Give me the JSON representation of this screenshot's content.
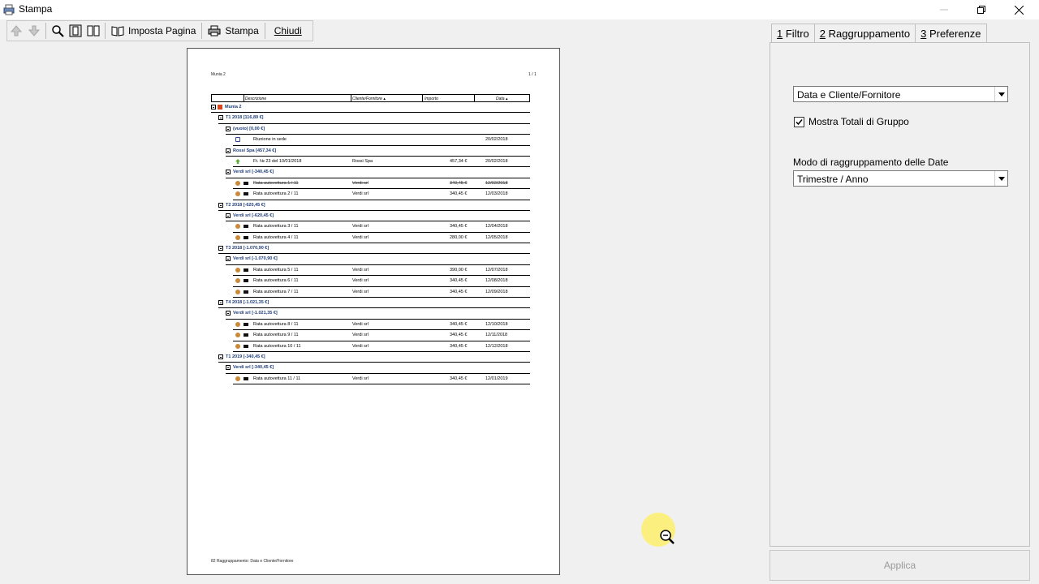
{
  "window": {
    "title": "Stampa"
  },
  "toolbar": {
    "page_setup_label": "Imposta Pagina",
    "print_label": "Stampa",
    "close_label": "Chiudi"
  },
  "preview": {
    "page_title": "Munia 2",
    "page_number": "1 / 1",
    "footer": "82 Raggruppamento: Data e Cliente/Fornitore",
    "columns": [
      "Descrizione",
      "Cliente/Fornitore ▴",
      "Importo",
      "Data ▴"
    ],
    "rows": [
      {
        "type": "group",
        "level": 0,
        "text": "Munia 2"
      },
      {
        "type": "group",
        "level": 1,
        "text": "T1 2018 [116,89 €]"
      },
      {
        "type": "group",
        "level": 2,
        "text": "(vuoto) [0,00 €]"
      },
      {
        "type": "item",
        "icon": "clock",
        "desc": "Riunione in sede",
        "client": "",
        "amount": "",
        "date": "20/02/2018"
      },
      {
        "type": "group",
        "level": 2,
        "text": "Rossi Spa [457,34 €]"
      },
      {
        "type": "item",
        "icon": "up-arrow",
        "desc": "Ft. № 23 del 10/01/2018",
        "client": "Rossi Spa",
        "amount": "457,34 €",
        "date": "20/02/2018"
      },
      {
        "type": "group",
        "level": 2,
        "text": "Verdi srl [-340,45 €]"
      },
      {
        "type": "item",
        "icon": "money",
        "strike": true,
        "desc": "Rata autovettura 1 / 11",
        "client": "Verdi srl",
        "amount": "340,45 €",
        "date": "12/02/2018"
      },
      {
        "type": "item",
        "icon": "money",
        "desc": "Rata autovettura 2 / 11",
        "client": "Verdi srl",
        "amount": "340,45 €",
        "date": "12/03/2018"
      },
      {
        "type": "group",
        "level": 1,
        "text": "T2 2018 [-620,45 €]"
      },
      {
        "type": "group",
        "level": 2,
        "text": "Verdi srl [-620,45 €]"
      },
      {
        "type": "item",
        "icon": "money",
        "desc": "Rata autovettura 3 / 11",
        "client": "Verdi srl",
        "amount": "340,45 €",
        "date": "12/04/2018"
      },
      {
        "type": "item",
        "icon": "money",
        "desc": "Rata autovettura 4 / 11",
        "client": "Verdi srl",
        "amount": "280,00 €",
        "date": "12/05/2018"
      },
      {
        "type": "group",
        "level": 1,
        "text": "T3 2018 [-1.070,90 €]"
      },
      {
        "type": "group",
        "level": 2,
        "text": "Verdi srl [-1.070,90 €]"
      },
      {
        "type": "item",
        "icon": "money",
        "desc": "Rata autovettura 5 / 11",
        "client": "Verdi srl",
        "amount": "390,00 €",
        "date": "12/07/2018"
      },
      {
        "type": "item",
        "icon": "money",
        "desc": "Rata autovettura 6 / 11",
        "client": "Verdi srl",
        "amount": "340,45 €",
        "date": "12/08/2018"
      },
      {
        "type": "item",
        "icon": "money",
        "desc": "Rata autovettura 7 / 11",
        "client": "Verdi srl",
        "amount": "340,45 €",
        "date": "12/09/2018"
      },
      {
        "type": "group",
        "level": 1,
        "text": "T4 2018 [-1.021,35 €]"
      },
      {
        "type": "group",
        "level": 2,
        "text": "Verdi srl [-1.021,35 €]"
      },
      {
        "type": "item",
        "icon": "money",
        "desc": "Rata autovettura 8 / 11",
        "client": "Verdi srl",
        "amount": "340,45 €",
        "date": "12/10/2018"
      },
      {
        "type": "item",
        "icon": "money",
        "desc": "Rata autovettura 9 / 11",
        "client": "Verdi srl",
        "amount": "340,45 €",
        "date": "12/11/2018"
      },
      {
        "type": "item",
        "icon": "money",
        "desc": "Rata autovettura 10 / 11",
        "client": "Verdi srl",
        "amount": "340,45 €",
        "date": "12/12/2018"
      },
      {
        "type": "group",
        "level": 1,
        "text": "T1 2019 [-340,45 €]"
      },
      {
        "type": "group",
        "level": 2,
        "text": "Verdi srl [-340,45 €]"
      },
      {
        "type": "item",
        "icon": "money",
        "desc": "Rata autovettura 11 / 11",
        "client": "Verdi srl",
        "amount": "340,45 €",
        "date": "12/01/2019"
      }
    ]
  },
  "tabs": [
    {
      "num": "1",
      "label": "Filtro"
    },
    {
      "num": "2",
      "label": "Raggruppamento"
    },
    {
      "num": "3",
      "label": "Preferenze"
    }
  ],
  "panel": {
    "grouping_select_value": "Data e Cliente/Fornitore",
    "show_totals_label": "Mostra Totali di Gruppo",
    "show_totals_checked": true,
    "date_mode_label": "Modo di raggruppamento delle Date",
    "date_mode_value": "Trimestre / Anno",
    "apply_label": "Applica"
  }
}
